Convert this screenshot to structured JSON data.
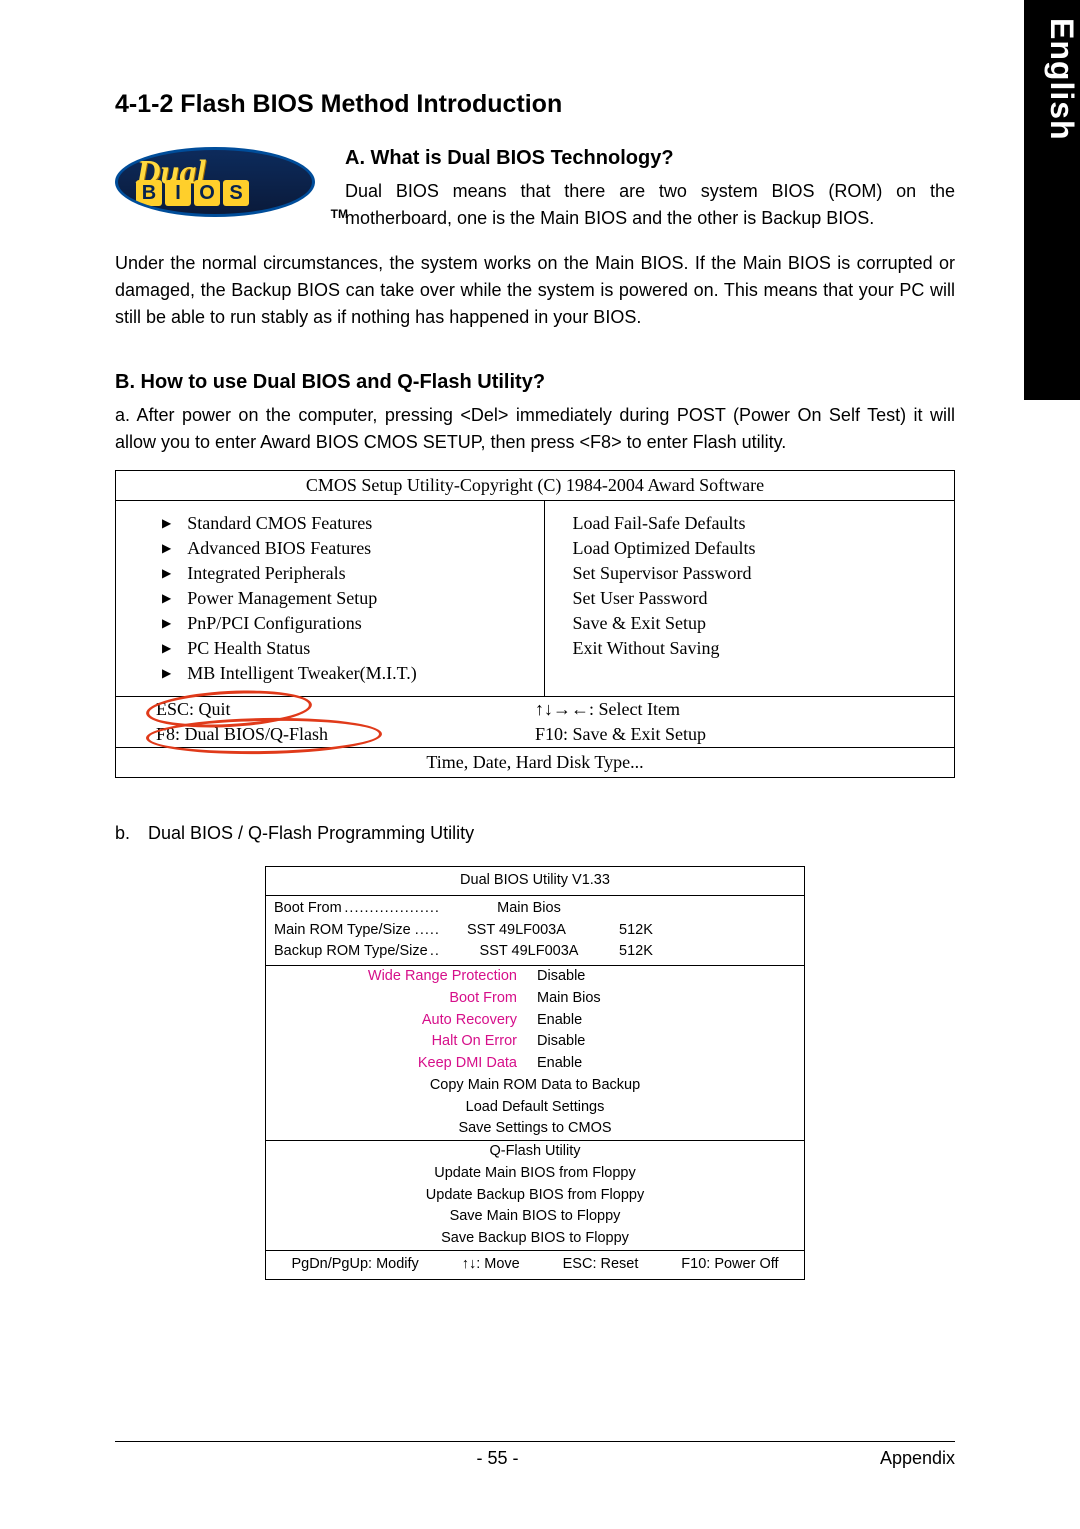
{
  "lang_tab": "English",
  "title": "4-1-2   Flash BIOS Method Introduction",
  "logo": {
    "word1": "Dual",
    "word2_letters": [
      "B",
      "I",
      "O",
      "S"
    ],
    "tm": "TM"
  },
  "secA": {
    "heading": "A.   What is Dual BIOS Technology?",
    "p1": "Dual BIOS means that there are two system BIOS (ROM) on the motherboard, one is the Main BIOS and the other is Backup BIOS.",
    "p2": "Under the normal circumstances, the system works on the Main BIOS. If the Main BIOS is corrupted or damaged, the Backup BIOS can take over while the system is powered on. This means that your PC will still be able to run stably as if nothing has happened in your BIOS."
  },
  "secB": {
    "heading": "B.   How to use Dual BIOS and Q-Flash Utility?",
    "pa": "a. After power on the computer, pressing <Del> immediately during POST (Power On Self Test) it will allow you to enter Award BIOS CMOS SETUP, then press <F8> to enter Flash utility.",
    "pb_label": "b.",
    "pb": "Dual BIOS / Q-Flash Programming Utility"
  },
  "cmos": {
    "header": "CMOS Setup Utility-Copyright (C) 1984-2004 Award Software",
    "left": [
      "Standard CMOS Features",
      "Advanced BIOS Features",
      "Integrated Peripherals",
      "Power Management Setup",
      "PnP/PCI Configurations",
      "PC Health Status",
      "MB Intelligent Tweaker(M.I.T.)"
    ],
    "right": [
      "Load Fail-Safe Defaults",
      "Load Optimized Defaults",
      "Set Supervisor Password",
      "Set User Password",
      "Save & Exit Setup",
      "Exit Without Saving"
    ],
    "foot": {
      "esc": "ESC: Quit",
      "select": "↑↓→←: Select Item",
      "f8": "F8: Dual BIOS/Q-Flash",
      "f10": "F10: Save & Exit Setup",
      "bottom": "Time, Date, Hard Disk Type..."
    }
  },
  "util": {
    "header": "Dual BIOS Utility V1.33",
    "info": [
      {
        "label": "Boot From",
        "mid": "Main Bios",
        "size": ""
      },
      {
        "label": "Main ROM Type/Size",
        "mid": "SST 49LF003A",
        "size": "512K"
      },
      {
        "label": "Backup ROM Type/Size",
        "mid": "SST 49LF003A",
        "size": "512K"
      }
    ],
    "opts": [
      {
        "label": "Wide Range Protection",
        "val": "Disable"
      },
      {
        "label": "Boot From",
        "val": "Main Bios"
      },
      {
        "label": "Auto Recovery",
        "val": "Enable"
      },
      {
        "label": "Halt On Error",
        "val": "Disable"
      },
      {
        "label": "Keep DMI Data",
        "val": "Enable"
      }
    ],
    "centered1": [
      "Copy Main ROM Data to Backup",
      "Load Default Settings",
      "Save Settings to CMOS"
    ],
    "qflash_label": "Q-Flash Utility",
    "centered2": [
      "Update Main BIOS from Floppy",
      "Update Backup BIOS from Floppy",
      "Save Main BIOS to Floppy",
      "Save Backup BIOS to Floppy"
    ],
    "footer": [
      "PgDn/PgUp: Modify",
      "↑↓: Move",
      "ESC: Reset",
      "F10: Power Off"
    ]
  },
  "footer": {
    "page": "- 55 -",
    "section": "Appendix"
  }
}
